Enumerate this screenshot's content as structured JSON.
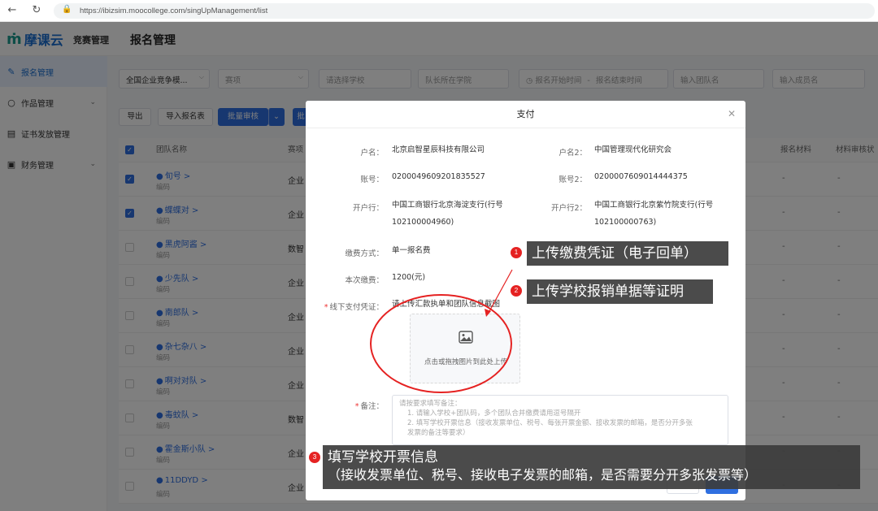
{
  "browser": {
    "url": "https://ibizsim.moocollege.com/singUpManagement/list"
  },
  "header": {
    "brand": "摩课云",
    "app_name": "竞赛管理",
    "page_title": "报名管理"
  },
  "sidebar": {
    "items": [
      {
        "label": "报名管理",
        "icon": "form-icon"
      },
      {
        "label": "作品管理",
        "icon": "bulb-icon"
      },
      {
        "label": "证书发放管理",
        "icon": "certificate-icon"
      },
      {
        "label": "财务管理",
        "icon": "finance-icon"
      }
    ]
  },
  "filters": {
    "competition": "全国企业竞争模...",
    "track": "赛项",
    "school": "请选择学校",
    "captain_school": "队长所在学院",
    "start_time": "报名开始时间",
    "end_time": "报名结束时间",
    "team_name": "输入团队名",
    "member_name": "输入成员名"
  },
  "toolbar": {
    "export": "导出",
    "import": "导入报名表",
    "batch_review": "批量审核",
    "batch": "批"
  },
  "table": {
    "headers": {
      "team": "团队名称",
      "track": "赛项",
      "report_material": "报名材料",
      "material_status": "材料审核状"
    },
    "rows": [
      {
        "team": "旬号",
        "code": "编码",
        "track": "企业",
        "checked": true
      },
      {
        "team": "蝶蝶对",
        "code": "编码",
        "track": "企业",
        "checked": true
      },
      {
        "team": "黑虎阿酱",
        "code": "编码",
        "track": "数智",
        "checked": false
      },
      {
        "team": "少先队",
        "code": "编码",
        "track": "企业",
        "checked": false
      },
      {
        "team": "南郎队",
        "code": "编码",
        "track": "企业",
        "checked": false
      },
      {
        "team": "杂七杂八",
        "code": "编码",
        "track": "企业",
        "checked": false
      },
      {
        "team": "啊对对队",
        "code": "编码",
        "track": "企业",
        "checked": false
      },
      {
        "team": "毒蚊队",
        "code": "编码",
        "track": "数智",
        "checked": false
      },
      {
        "team": "霍金斯小队",
        "code": "编码",
        "track": "企业",
        "checked": false
      },
      {
        "team": "11DDYD",
        "code": "编码",
        "track": "企业",
        "checked": false
      }
    ],
    "dash": "-"
  },
  "modal": {
    "title": "支付",
    "account_name_label": "户名：",
    "account_name": "北京启智星辰科技有限公司",
    "account_name2_label": "户名2：",
    "account_name2": "中国管理现代化研究会",
    "account_no_label": "账号：",
    "account_no": "0200049609201835527",
    "account_no2_label": "账号2：",
    "account_no2": "0200007609014444375",
    "bank_label": "开户行：",
    "bank_line1": "中国工商银行北京海淀支行(行号",
    "bank_line2": "102100004960)",
    "bank2_label": "开户行2：",
    "bank2_line1": "中国工商银行北京紫竹院支行(行号",
    "bank2_line2": "102100000763)",
    "pay_method_label": "缴费方式：",
    "pay_method": "单一报名费",
    "amount_label": "本次缴费：",
    "amount": "1200(元)",
    "voucher_label": "线下支付凭证：",
    "voucher_hint": "请上传汇款执单和团队信息截图",
    "upload_tip": "点击或拖拽图片到此处上传",
    "remark_label": "备注：",
    "remark_placeholder_1": "请按要求填写备注：",
    "remark_placeholder_2": "1. 请输入学校+团队码，多个团队合并缴费请用逗号隔开",
    "remark_placeholder_3": "2. 填写学校开票信息（接收发票单位、税号、每张开票金额、接收发票的邮箱，是否分开多张",
    "remark_placeholder_4": "发票的备注等要求）"
  },
  "annotations": {
    "note1_num": "1",
    "note1": "上传缴费凭证（电子回单）",
    "note2_num": "2",
    "note2": "上传学校报销单据等证明",
    "note3_num": "3",
    "note3_line1": "填写学校开票信息",
    "note3_line2": "（接收发票单位、税号、接收电子发票的邮箱，是否需要分开多张发票等）"
  },
  "colors": {
    "primary": "#2f6fe0",
    "annotation_red": "#e52222",
    "callout_bg": "#3c3c3c"
  }
}
